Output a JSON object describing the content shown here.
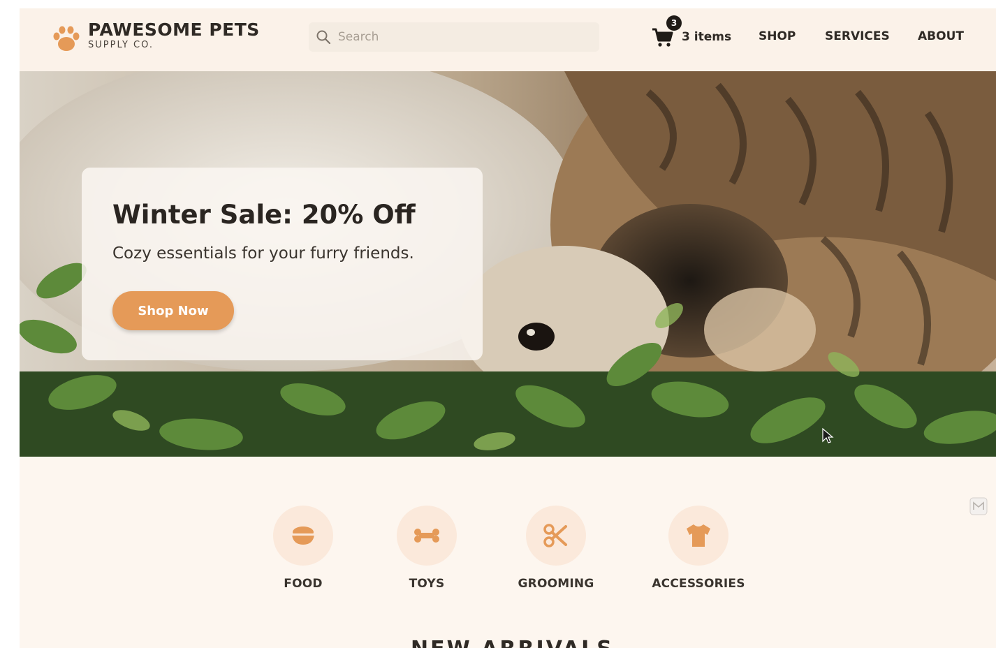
{
  "brand": {
    "name": "PAWESOME PETS",
    "sub": "SUPPLY CO.",
    "accent_color": "#e59a58"
  },
  "search": {
    "placeholder": "Search",
    "icon": "search-icon"
  },
  "cart": {
    "count": "3",
    "label": "3 items",
    "icon": "cart-icon"
  },
  "nav": {
    "items": [
      {
        "label": "SHOP"
      },
      {
        "label": "SERVICES"
      },
      {
        "label": "ABOUT"
      }
    ]
  },
  "hero": {
    "title": "Winter Sale: 20% Off",
    "subtitle": "Cozy essentials for your furry friends.",
    "cta_label": "Shop Now"
  },
  "categories": [
    {
      "label": "FOOD",
      "icon": "food-bowl-icon"
    },
    {
      "label": "TOYS",
      "icon": "bone-icon"
    },
    {
      "label": "GROOMING",
      "icon": "scissors-icon"
    },
    {
      "label": "ACCESSORIES",
      "icon": "tshirt-icon"
    }
  ],
  "sections": {
    "new_arrivals_title": "NEW ARRIVALS"
  }
}
